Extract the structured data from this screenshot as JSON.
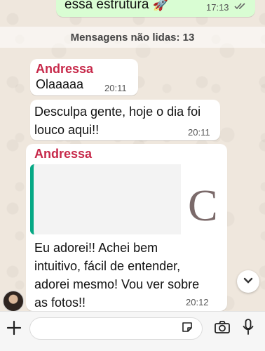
{
  "outgoing_top": {
    "text": "essa estrutura 🚀",
    "time": "17:13"
  },
  "unread_banner": "Mensagens não lidas: 13",
  "messages": [
    {
      "sender": "Andressa",
      "text": "Olaaaaa",
      "time": "20:11"
    },
    {
      "text_line1": "Desculpa gente, hoje o dia foi",
      "text_line2": "louco aqui!!",
      "time": "20:11"
    },
    {
      "sender": "Andressa",
      "quote_thumb_char": "C",
      "lines": [
        "Eu adorei!! Achei bem",
        "intuitivo, fácil de entender,",
        "adorei mesmo! Vou ver sobre",
        "as fotos!!"
      ],
      "time": "20:12"
    }
  ],
  "icons": {
    "attach": "plus-icon",
    "sticker": "sticker-icon",
    "camera": "camera-icon",
    "mic": "microphone-icon",
    "scroll": "chevron-down-icon",
    "read": "double-check-icon"
  },
  "colors": {
    "sender": "#c7294a",
    "quote_bar": "#06a884",
    "outgoing_bg": "#d9fdd3"
  }
}
